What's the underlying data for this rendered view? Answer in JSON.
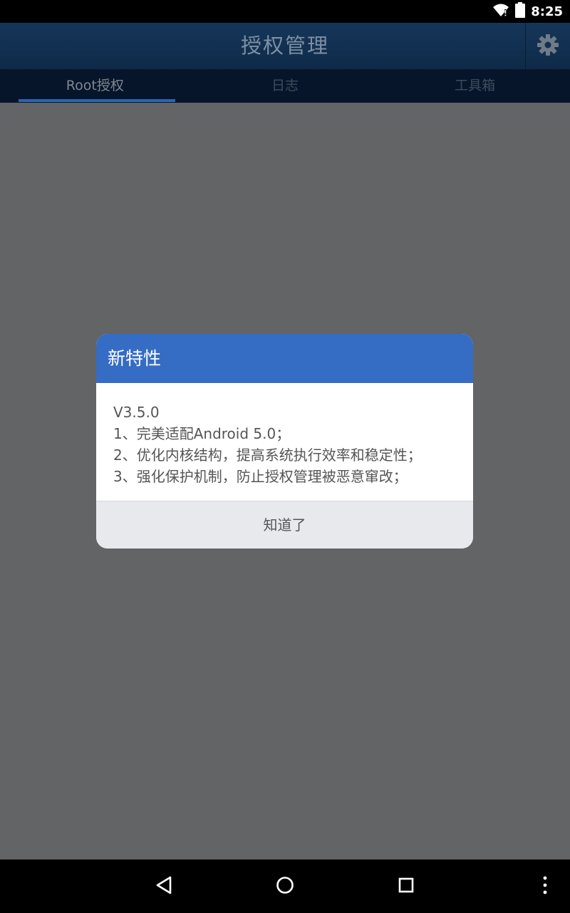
{
  "status_bar": {
    "time": "8:25",
    "icons": [
      "wifi-icon",
      "battery-icon"
    ]
  },
  "app_bar": {
    "title": "授权管理",
    "settings_icon": "gear-icon"
  },
  "tabs": [
    {
      "label": "Root授权",
      "active": true
    },
    {
      "label": "日志",
      "active": false
    },
    {
      "label": "工具箱",
      "active": false
    }
  ],
  "dialog": {
    "title": "新特性",
    "lines": [
      "V3.5.0",
      "1、完美适配Android 5.0；",
      "2、优化内核结构，提高系统执行效率和稳定性；",
      "3、强化保护机制，防止授权管理被恶意窜改；"
    ],
    "confirm_label": "知道了"
  },
  "nav_bar": {
    "icons": [
      "back-icon",
      "home-icon",
      "recents-icon",
      "more-icon"
    ]
  },
  "colors": {
    "dialog_header": "#356cc4",
    "tab_indicator": "#2a66b3",
    "overlay": "#636466"
  }
}
